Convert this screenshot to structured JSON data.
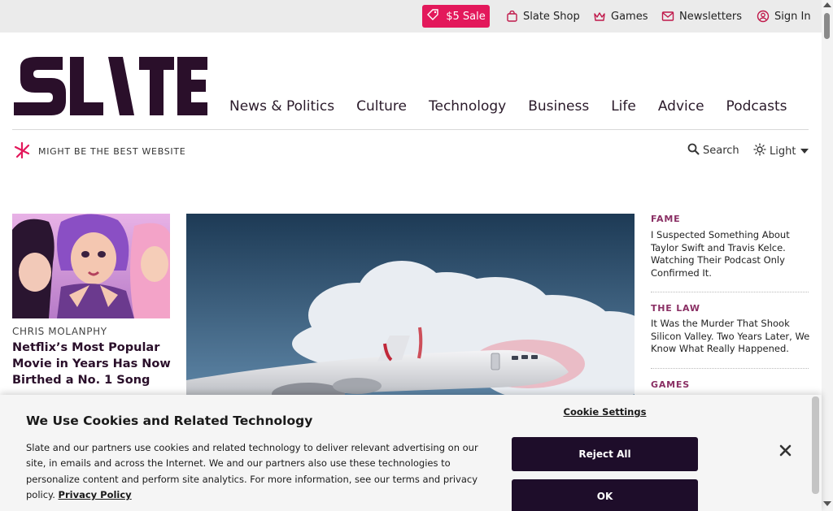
{
  "topbar": {
    "sale_label": "$5 Sale",
    "shop_label": "Slate Shop",
    "games_label": "Games",
    "newsletters_label": "Newsletters",
    "signin_label": "Sign In"
  },
  "brand": {
    "logo_text": "SLATE",
    "tagline": "MIGHT BE THE BEST WEBSITE",
    "accent_color": "#e3185b",
    "logo_color": "#2a0f2a"
  },
  "nav": {
    "items": [
      "News & Politics",
      "Culture",
      "Technology",
      "Business",
      "Life",
      "Advice",
      "Podcasts"
    ]
  },
  "controls": {
    "search_label": "Search",
    "theme_label": "Light"
  },
  "left_story": {
    "byline": "CHRIS MOLANPHY",
    "headline": "Netflix’s Most Popular Movie in Years Has Now Birthed a No. 1 Song"
  },
  "right_column": {
    "items": [
      {
        "kicker": "FAME",
        "headline": "I Suspected Something About Taylor Swift and Travis Kelce. Watching Their Podcast Only Confirmed It."
      },
      {
        "kicker": "THE LAW",
        "headline": "It Was the Murder That Shook Silicon Valley. Two Years Later, We Know What Really Happened."
      },
      {
        "kicker": "GAMES",
        "headline": ""
      }
    ]
  },
  "cookie_banner": {
    "title": "We Use Cookies and Related Technology",
    "body": "Slate and our partners use cookies and related technology to deliver relevant advertising on our site, in emails and across the Internet. We and our partners also use these technologies to personalize content and perform site analytics. For more information, see our terms and privacy policy.",
    "privacy_link": "Privacy Policy",
    "settings_label": "Cookie Settings",
    "reject_label": "Reject All",
    "ok_label": "OK"
  }
}
